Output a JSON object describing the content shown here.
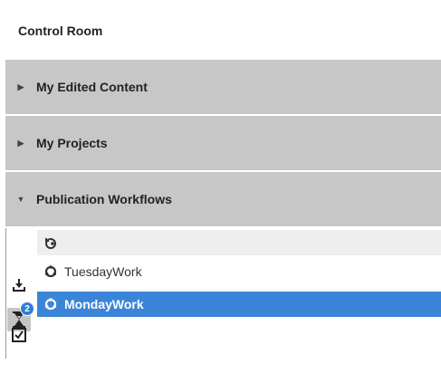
{
  "page": {
    "title": "Control Room"
  },
  "accordion": {
    "sections": [
      {
        "label": "My Edited Content",
        "expanded": false
      },
      {
        "label": "My Projects",
        "expanded": false
      },
      {
        "label": "Publication Workflows",
        "expanded": true
      }
    ]
  },
  "workflows": {
    "header_icon": "workflow-refresh-icon",
    "items": [
      {
        "label": "TuesdayWork",
        "icon": "workflow-icon",
        "selected": false
      },
      {
        "label": "MondayWork",
        "icon": "workflow-icon",
        "selected": true
      }
    ]
  },
  "toolbar": {
    "download_icon": "download-icon",
    "tasks_icon": "hourglass-icon",
    "tasks_badge": "2",
    "check_icon": "checkbox-icon"
  },
  "colors": {
    "header_bg": "#c8c7c8",
    "selected_row": "#3b85d8",
    "badge": "#2e7fd9"
  }
}
